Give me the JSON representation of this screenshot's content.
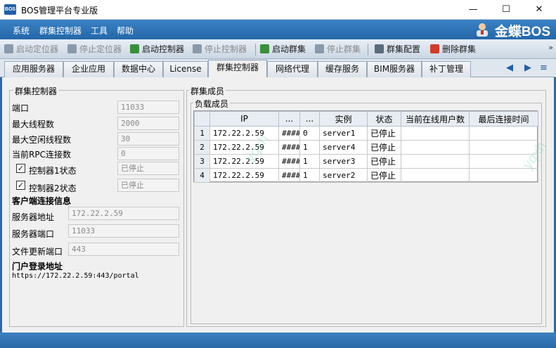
{
  "window": {
    "title": "BOS管理平台专业版",
    "logo_text": "BOS",
    "minimize": "—",
    "maximize": "☐",
    "close": "✕"
  },
  "menu": [
    "系统",
    "群集控制器",
    "工具",
    "帮助"
  ],
  "brand": "金蝶BOS",
  "toolbar": {
    "buttons": [
      {
        "label": "启动定位器",
        "enabled": false
      },
      {
        "label": "停止定位器",
        "enabled": false
      },
      {
        "label": "启动控制器",
        "enabled": true
      },
      {
        "label": "停止控制器",
        "enabled": false
      },
      {
        "label": "启动群集",
        "enabled": true
      },
      {
        "label": "停止群集",
        "enabled": false
      },
      {
        "label": "群集配置",
        "enabled": true
      },
      {
        "label": "删除群集",
        "enabled": true
      }
    ],
    "more": "»"
  },
  "tabs": [
    "应用服务器",
    "企业应用",
    "数据中心",
    "License",
    "群集控制器",
    "网络代理",
    "缓存服务",
    "BIM服务器",
    "补丁管理"
  ],
  "active_tab": "群集控制器",
  "tab_nav": {
    "prev": "◀",
    "next": "▶",
    "list": "≡"
  },
  "left_panel": {
    "title": "群集控制器",
    "port_label": "端口",
    "port_value": "11033",
    "max_threads_label": "最大线程数",
    "max_threads_value": "2000",
    "max_idle_label": "最大空闲线程数",
    "max_idle_value": "30",
    "rpc_label": "当前RPC连接数",
    "rpc_value": "0",
    "ctrl1_label": "控制器1状态",
    "ctrl1_value": "已停止",
    "ctrl2_label": "控制器2状态",
    "ctrl2_value": "已停止",
    "checkmark": "✓",
    "client_heading": "客户端连接信息",
    "server_addr_label": "服务器地址",
    "server_addr_value": "172.22.2.59",
    "server_port_label": "服务器端口",
    "server_port_value": "11033",
    "file_port_label": "文件更新端口",
    "file_port_value": "443",
    "portal_heading": "门户登录地址",
    "portal_url": "https://172.22.2.59:443/portal"
  },
  "right_panel": {
    "title": "群集成员",
    "subgroup": "负载成员",
    "columns": [
      "",
      "IP",
      "...",
      "...",
      "实例",
      "状态",
      "当前在线用户数",
      "最后连接时间"
    ],
    "rows": [
      [
        "1",
        "172.22.2.59",
        "####",
        "0",
        "server1",
        "已停止",
        "",
        ""
      ],
      [
        "2",
        "172.22.2.59",
        "####",
        "1",
        "server4",
        "已停止",
        "",
        ""
      ],
      [
        "3",
        "172.22.2.59",
        "####",
        "1",
        "server3",
        "已停止",
        "",
        ""
      ],
      [
        "4",
        "172.22.2.59",
        "####",
        "1",
        "server2",
        "已停止",
        "",
        ""
      ]
    ]
  },
  "watermark": "yqxh"
}
